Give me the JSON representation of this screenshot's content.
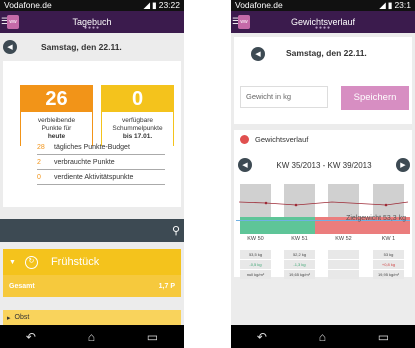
{
  "status": {
    "carrier": "Vodafone.de",
    "time": "23:22",
    "time2": "23:1"
  },
  "p1": {
    "title": "Tagebuch",
    "date": "Samstag, den 22.11.",
    "remaining": {
      "value": "26",
      "line1": "verbleibende",
      "line2": "Punkte für",
      "line3": "heute"
    },
    "available": {
      "value": "0",
      "line1": "verfügbare",
      "line2": "Schummelpunkte",
      "line3": "bis 17.01."
    },
    "stats": [
      {
        "num": "28",
        "label": "tägliches Punkte-Budget"
      },
      {
        "num": "2",
        "label": "verbrauchte Punkte"
      },
      {
        "num": "0",
        "label": "verdiente Aktivitätspunkte"
      }
    ],
    "meal_name": "Frühstück",
    "total_label": "Gesamt",
    "total_value": "1,7 P",
    "obst": "Obst"
  },
  "p2": {
    "title": "Gewichtsverlauf",
    "date": "Samstag, den 22.11.",
    "weight_placeholder": "Gewicht in kg",
    "save_label": "Speichern",
    "section_title": "Gewichtsverlauf",
    "range": "KW 35/2013 - KW 39/2013",
    "goal_label": "Zielgewicht 53,3 kg",
    "kw": [
      "KW 50",
      "KW 51",
      "KW 52",
      "KW 1"
    ],
    "rows": [
      [
        "53,5 kg",
        "52,2 kg",
        "",
        "53 kg"
      ],
      [
        "-0,5 kg",
        "-1,3 kg",
        "",
        "+0,8 kg"
      ],
      [
        "null kg/m²",
        "19,65 kg/m²",
        "",
        "19,95 kg/m²"
      ]
    ]
  },
  "colors": {
    "purple": "#3b1b4d",
    "orange": "#f29418",
    "yellow": "#f4c31c",
    "pink": "#d78ec2"
  }
}
